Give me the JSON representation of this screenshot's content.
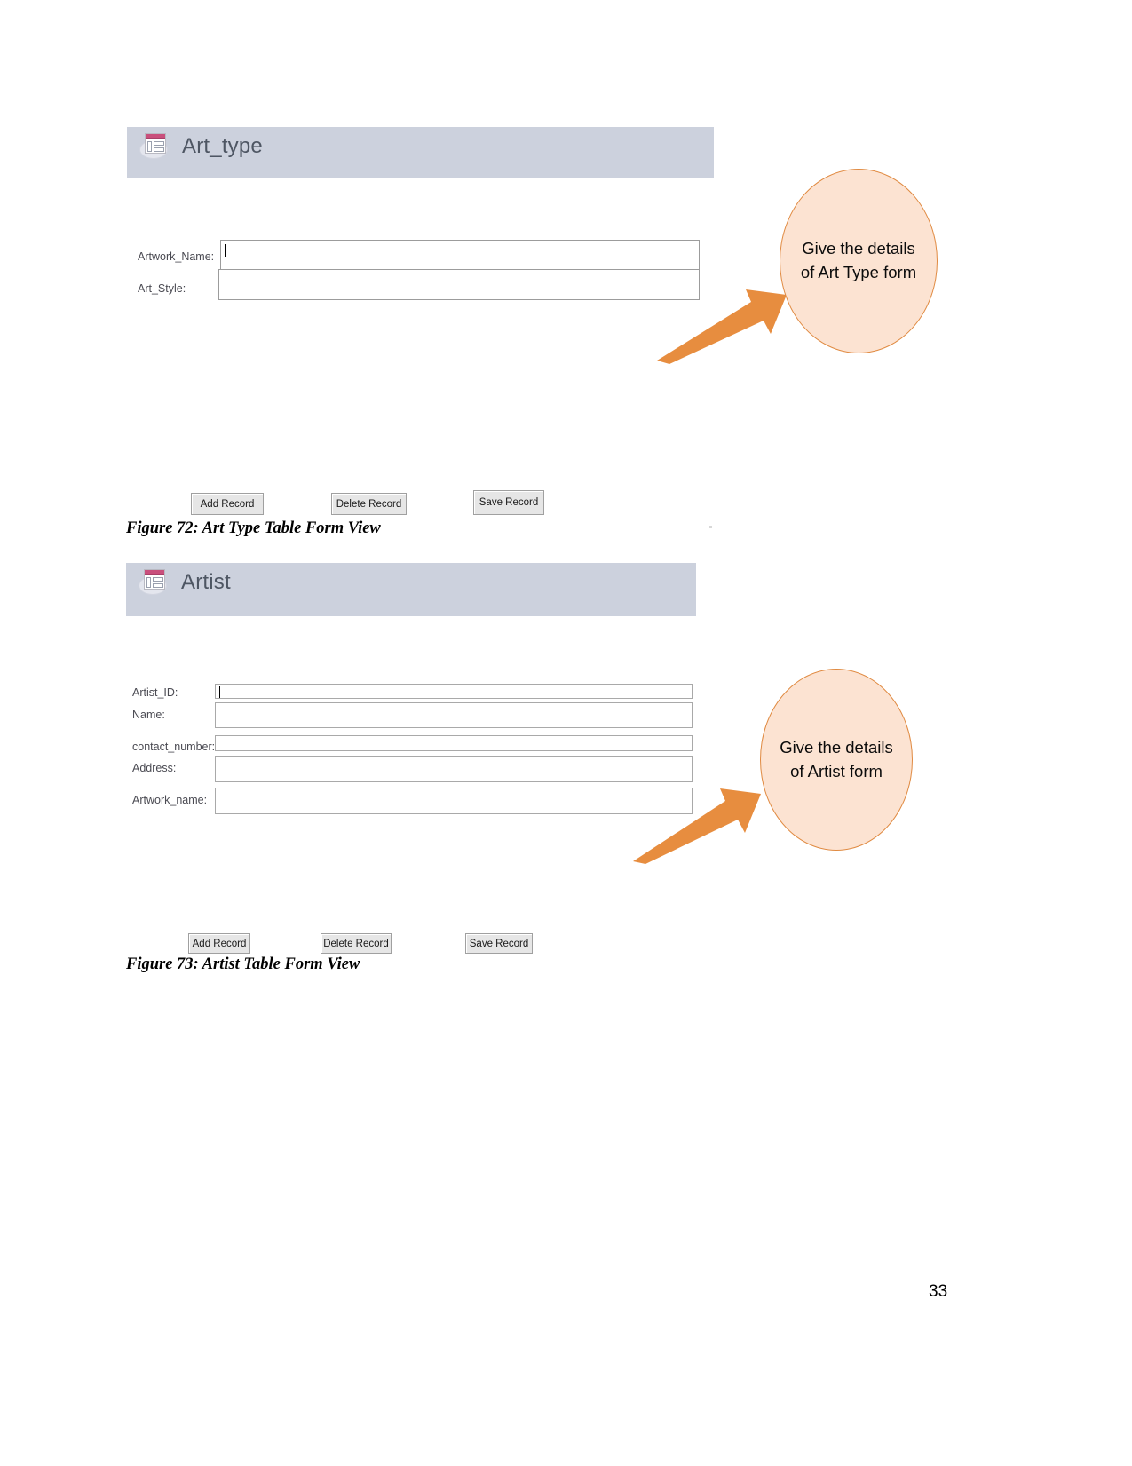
{
  "document": {
    "page_number": "33"
  },
  "figures": [
    {
      "form": {
        "title": "Art_type",
        "icon": "access-form-icon",
        "fields": [
          {
            "label": "Artwork_Name:",
            "value": "",
            "focused": true
          },
          {
            "label": "Art_Style:",
            "value": "",
            "focused": false
          }
        ],
        "buttons": [
          {
            "label": "Add Record"
          },
          {
            "label": "Delete Record"
          },
          {
            "label": "Save Record"
          }
        ]
      },
      "callout": {
        "text": "Give the details of Art Type form",
        "fill_color": "#fce3d2",
        "border_color": "#e08a41",
        "arrow_color": "#e78d3f"
      },
      "caption": "Figure 72: Art Type Table Form View"
    },
    {
      "form": {
        "title": "Artist",
        "icon": "access-form-icon",
        "fields": [
          {
            "label": "Artist_ID:",
            "value": "",
            "focused": true
          },
          {
            "label": "Name:",
            "value": "",
            "focused": false
          },
          {
            "label": "contact_number:",
            "value": "",
            "focused": false
          },
          {
            "label": "Address:",
            "value": "",
            "focused": false
          },
          {
            "label": "Artwork_name:",
            "value": "",
            "focused": false
          }
        ],
        "buttons": [
          {
            "label": "Add Record"
          },
          {
            "label": "Delete Record"
          },
          {
            "label": "Save Record"
          }
        ]
      },
      "callout": {
        "text": "Give the details of Artist form",
        "fill_color": "#fce3d2",
        "border_color": "#e08a41",
        "arrow_color": "#e78d3f"
      },
      "caption": "Figure 73: Artist Table Form View"
    }
  ]
}
